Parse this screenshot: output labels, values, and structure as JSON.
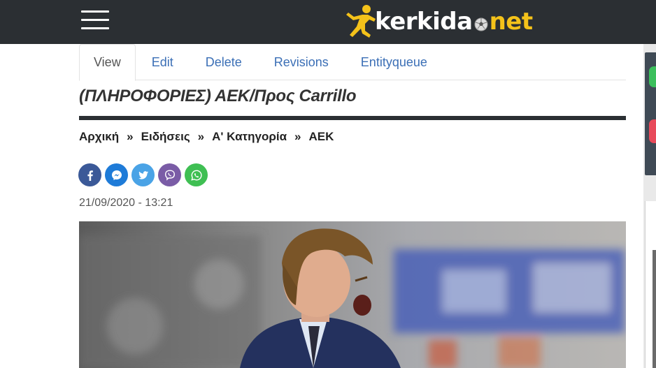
{
  "site": {
    "logo_main": "kerkida",
    "logo_tld": "net",
    "accent_color": "#f4c21a",
    "header_color": "#2b2f33"
  },
  "tabs": [
    {
      "label": "View",
      "active": true
    },
    {
      "label": "Edit",
      "active": false
    },
    {
      "label": "Delete",
      "active": false
    },
    {
      "label": "Revisions",
      "active": false
    },
    {
      "label": "Entityqueue",
      "active": false
    }
  ],
  "article": {
    "title": "(ΠΛΗΡΟΦΟΡΙΕΣ) ΑΕΚ/Προς Carrillo",
    "date": "21/09/2020 - 13:21"
  },
  "breadcrumb": {
    "separator": "»",
    "items": [
      "Αρχική",
      "Ειδήσεις",
      "Α' Κατηγορία",
      "ΑΕΚ"
    ]
  },
  "share": [
    {
      "icon": "facebook-icon"
    },
    {
      "icon": "messenger-icon"
    },
    {
      "icon": "twitter-icon"
    },
    {
      "icon": "viber-icon"
    },
    {
      "icon": "whatsapp-icon"
    }
  ]
}
